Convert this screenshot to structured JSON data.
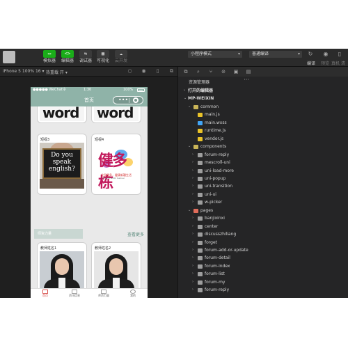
{
  "toolbar": {
    "buttons": [
      {
        "label": "模拟器",
        "glyph": "▭"
      },
      {
        "label": "编辑器",
        "glyph": "<>"
      },
      {
        "label": "调试器",
        "glyph": "⇆"
      },
      {
        "label": "可视化",
        "glyph": "▦"
      },
      {
        "label": "云开发",
        "glyph": "☁"
      }
    ],
    "mode_select": "小程序模式",
    "compile_select": "普通编译",
    "right_labels": [
      "编译",
      "预览",
      "真机",
      "清缓"
    ]
  },
  "simbar": {
    "device": "iPhone 5 100% 16 ▾",
    "hotreload": "热重载 开 ▾"
  },
  "phone": {
    "status_left": "●●●●● WeChat令",
    "status_time": "1:30",
    "status_batt": "100%",
    "nav_title": "首页",
    "top_card_text": "word",
    "cards": [
      {
        "title": "短视3",
        "blackboard": "Do you speak english?"
      },
      {
        "title": "短视4",
        "calligraphy": "健多栋",
        "sub1": "全民健身，健康新疆生活",
        "sub2": "Double width festival"
      }
    ],
    "section_label": "师资力量",
    "section_more": "查看更多",
    "teachers": [
      {
        "title": "教师姓名1"
      },
      {
        "title": "教师姓名2"
      }
    ],
    "tabs": [
      "首页",
      "资讯信息",
      "师资力量",
      "我的"
    ]
  },
  "explorer": {
    "header": "资源管理器",
    "more": "···",
    "items": [
      {
        "label": "打开的编辑器",
        "level": 0,
        "type": "section",
        "arrow": "›"
      },
      {
        "label": "MP-WEIXIN",
        "level": 0,
        "type": "section",
        "arrow": "⌄"
      },
      {
        "label": "common",
        "level": 1,
        "type": "folder-open",
        "arrow": "⌄"
      },
      {
        "label": "main.js",
        "level": 2,
        "type": "js",
        "arrow": ""
      },
      {
        "label": "main.wxss",
        "level": 2,
        "type": "wxss",
        "arrow": ""
      },
      {
        "label": "runtime.js",
        "level": 2,
        "type": "js",
        "arrow": ""
      },
      {
        "label": "vendor.js",
        "level": 2,
        "type": "js",
        "arrow": ""
      },
      {
        "label": "components",
        "level": 1,
        "type": "folder-open",
        "arrow": "⌄"
      },
      {
        "label": "forum-reply",
        "level": 2,
        "type": "folder",
        "arrow": "›"
      },
      {
        "label": "mescroll-uni",
        "level": 2,
        "type": "folder",
        "arrow": "›"
      },
      {
        "label": "uni-load-more",
        "level": 2,
        "type": "folder",
        "arrow": "›"
      },
      {
        "label": "uni-popup",
        "level": 2,
        "type": "folder",
        "arrow": "›"
      },
      {
        "label": "uni-transition",
        "level": 2,
        "type": "folder",
        "arrow": "›"
      },
      {
        "label": "uni-ui",
        "level": 2,
        "type": "folder",
        "arrow": "›"
      },
      {
        "label": "w-picker",
        "level": 2,
        "type": "folder",
        "arrow": "›"
      },
      {
        "label": "pages",
        "level": 1,
        "type": "folder-pages",
        "arrow": "⌄"
      },
      {
        "label": "banjixinxi",
        "level": 2,
        "type": "folder",
        "arrow": "›"
      },
      {
        "label": "center",
        "level": 2,
        "type": "folder",
        "arrow": "›"
      },
      {
        "label": "discusszhiliang",
        "level": 2,
        "type": "folder",
        "arrow": "›"
      },
      {
        "label": "forget",
        "level": 2,
        "type": "folder",
        "arrow": "›"
      },
      {
        "label": "forum-add-or-update",
        "level": 2,
        "type": "folder",
        "arrow": "›"
      },
      {
        "label": "forum-detail",
        "level": 2,
        "type": "folder",
        "arrow": "›"
      },
      {
        "label": "forum-index",
        "level": 2,
        "type": "folder",
        "arrow": "›"
      },
      {
        "label": "forum-list",
        "level": 2,
        "type": "folder",
        "arrow": "›"
      },
      {
        "label": "forum-my",
        "level": 2,
        "type": "folder",
        "arrow": "›"
      },
      {
        "label": "forum-reply",
        "level": 2,
        "type": "folder",
        "arrow": "›"
      }
    ]
  }
}
